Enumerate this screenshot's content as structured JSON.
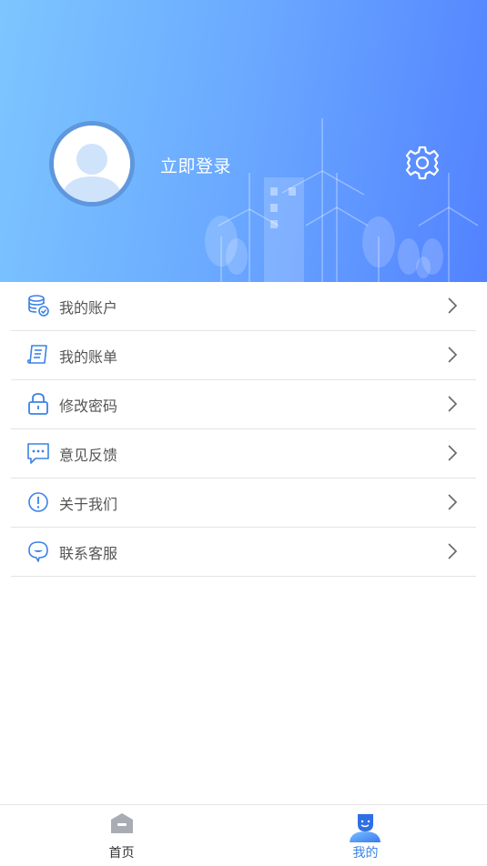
{
  "header": {
    "login_label": "立即登录",
    "avatar_icon": "user-avatar-icon",
    "settings_icon": "gear-icon"
  },
  "menu": {
    "items": [
      {
        "label": "我的账户",
        "icon": "database-icon"
      },
      {
        "label": "我的账单",
        "icon": "bill-icon"
      },
      {
        "label": "修改密码",
        "icon": "lock-icon"
      },
      {
        "label": "意见反馈",
        "icon": "message-icon"
      },
      {
        "label": "关于我们",
        "icon": "info-icon"
      },
      {
        "label": "联系客服",
        "icon": "service-chat-icon"
      }
    ]
  },
  "tabbar": {
    "tabs": [
      {
        "label": "首页",
        "icon": "home-icon",
        "active": false
      },
      {
        "label": "我的",
        "icon": "profile-icon",
        "active": true
      }
    ]
  },
  "colors": {
    "accent": "#3b82e6",
    "header_gradient_start": "#7cc6ff",
    "header_gradient_end": "#5282ff",
    "menu_text": "#555555",
    "tab_inactive": "#333333"
  }
}
